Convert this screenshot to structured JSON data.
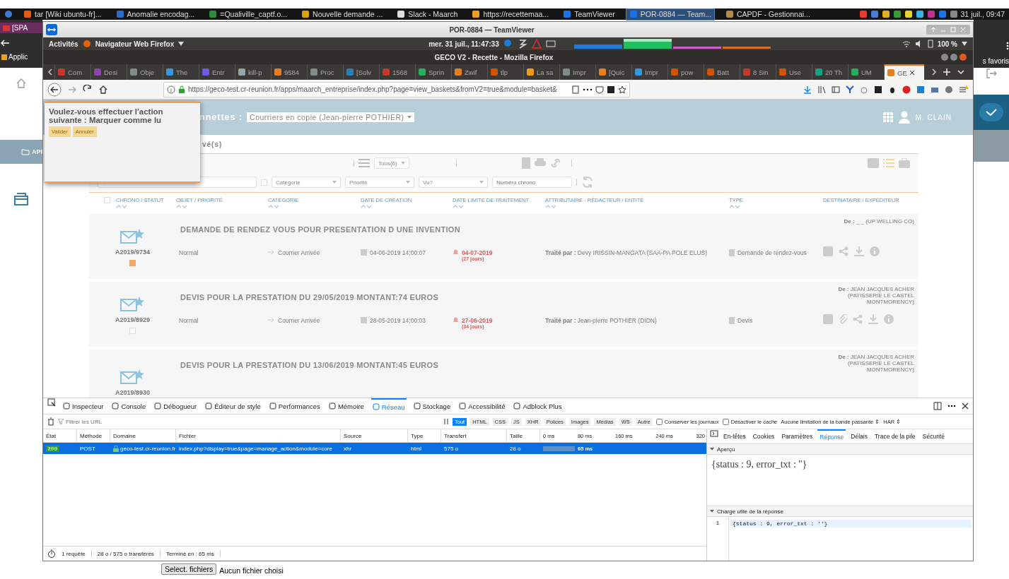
{
  "taskbar": {
    "items": [
      {
        "label": "tar [Wiki ubuntu-fr]...",
        "selected": false
      },
      {
        "label": "Anomalie encodag...",
        "selected": false
      },
      {
        "label": "=Qualiville_captf.o...",
        "selected": false
      },
      {
        "label": "Nouvelle demande ...",
        "selected": false
      },
      {
        "label": "Slack - Maarch",
        "selected": false
      },
      {
        "label": "https://recettemaa...",
        "selected": false
      },
      {
        "label": "TeamViewer",
        "selected": false
      },
      {
        "label": "POR-0884 — Team...",
        "selected": true
      },
      {
        "label": "CAPDF - Gestionnai...",
        "selected": false
      }
    ],
    "clock": "31 juil., 09:47"
  },
  "background_window": {
    "tab": "[SPA",
    "launcher": "Applic",
    "bookmarks": "s favoris",
    "side_label": "API",
    "file_button": "Select. fichiers",
    "file_status": "Aucun fichier choisi"
  },
  "teamviewer": {
    "title": "POR-0884 — TeamViewer"
  },
  "remote_topbar": {
    "activities": "Activités",
    "app_menu": "Navigateur Web Firefox",
    "clock": "mer. 31 juil., 11:47:33",
    "battery": "100 %"
  },
  "firefox": {
    "title": "GECO V2 - Recette - Mozilla Firefox",
    "tabs": [
      {
        "label": "Com",
        "selected": false
      },
      {
        "label": "Desi",
        "selected": false
      },
      {
        "label": "Obje",
        "selected": false
      },
      {
        "label": "The",
        "selected": false
      },
      {
        "label": "Entr",
        "selected": false
      },
      {
        "label": "kill-p",
        "selected": false
      },
      {
        "label": "9584",
        "selected": false
      },
      {
        "label": "Proc",
        "selected": false
      },
      {
        "label": "[Solv",
        "selected": false
      },
      {
        "label": "1568",
        "selected": false
      },
      {
        "label": "Sprin",
        "selected": false
      },
      {
        "label": "Zwif",
        "selected": false
      },
      {
        "label": "tlp",
        "selected": false
      },
      {
        "label": "La sa",
        "selected": false
      },
      {
        "label": "Impr",
        "selected": false
      },
      {
        "label": "[Quic",
        "selected": false
      },
      {
        "label": "Impr",
        "selected": false
      },
      {
        "label": "pow",
        "selected": false
      },
      {
        "label": "Batt",
        "selected": false
      },
      {
        "label": "8 Sin",
        "selected": false
      },
      {
        "label": "Use",
        "selected": false
      },
      {
        "label": "20 Th",
        "selected": false
      },
      {
        "label": "UM",
        "selected": false
      },
      {
        "label": "GE",
        "selected": true
      }
    ],
    "url": "https://geco-test.cr-reunion.fr/apps/maarch_entreprise/index.php?page=view_baskets&fromV2=true&module=basket&"
  },
  "page": {
    "header": {
      "basket_label": "nnettes :",
      "basket_select": "Courriers en copie (Jean-pierre POTHIER)",
      "user": "M. CLAIN"
    },
    "subtitle": "vé(s)",
    "toolbar": {
      "filter_checkbox": {
        "checked": false
      },
      "select_all": {
        "checked": false
      },
      "count_select": "Tous(6)",
      "filters": [
        "Catégorie",
        "Priorité",
        "Vu?"
      ],
      "chrono_placeholder": "Numéro chrono"
    },
    "columns": [
      "CHRONO / STATUT",
      "OBJET / PRIORITÉ",
      "CATÉGORIE",
      "DATE DE CRÉATION",
      "DATE LIMITE DE TRAITEMENT",
      "ATTRIBUTAIRE - RÉDACTEUR / ENTITÉ",
      "TYPE",
      "DESTINATAIRE / EXPÉDITEUR"
    ],
    "rows": [
      {
        "chrono": "A2019/9734",
        "checked": true,
        "subject": "DEMANDE DE RENDEZ VOUS POUR PRESENTATION D UNE INVENTION",
        "contact": "**De :** _ _ (UP WELLING CO)",
        "priority": "Normal",
        "category": "Courrier Arrivée",
        "created": "04-06-2019 14:00:07",
        "deadline": "04-07-2019",
        "remaining": "(27 jours)",
        "assignee": "**Traité par :** Devy IRISSIN-MANGATA (SAA-PA POLE ELUS)",
        "type": "Demande de rendez-vous",
        "attachment": false
      },
      {
        "chrono": "A2019/8929",
        "checked": false,
        "subject": "DEVIS POUR LA PRESTATION DU 29/05/2019 MONTANT:74 EUROS",
        "contact": "**De :** JEAN JACQUES ACHER (PATISSERIE LE CASTEL MONTMORENCY)",
        "priority": "Normal",
        "category": "Courrier Arrivée",
        "created": "28-05-2019 14:00:03",
        "deadline": "27-06-2019",
        "remaining": "(34 jours)",
        "assignee": "**Traité par :** Jean-pierre POTHIER (DIDN)",
        "type": "Devis",
        "attachment": true
      },
      {
        "chrono": "A2019/8930",
        "subject": "DEVIS POUR LA PRESTATION DU 13/06/2019 MONTANT:45 EUROS",
        "contact": "**De :** JEAN JACQUES ACHER (PATISSERIE LE CASTEL MONTMORENCY)"
      }
    ],
    "dialog": {
      "message": "Voulez-vous effectuer l'action suivante : Marquer comme lu",
      "buttons": [
        "Valider",
        "Annuler"
      ]
    }
  },
  "devtools": {
    "tabs": [
      {
        "label": "Inspecteur",
        "selected": false
      },
      {
        "label": "Console",
        "selected": false
      },
      {
        "label": "Débogueur",
        "selected": false
      },
      {
        "label": "Éditeur de style",
        "selected": false
      },
      {
        "label": "Performances",
        "selected": false
      },
      {
        "label": "Mémoire",
        "selected": false
      },
      {
        "label": "Réseau",
        "selected": true
      },
      {
        "label": "Stockage",
        "selected": false
      },
      {
        "label": "Accessibilité",
        "selected": false
      },
      {
        "label": "Adblock Plus",
        "selected": false
      }
    ],
    "filter_placeholder": "Filtrer les URL",
    "type_filters": [
      {
        "label": "Tout",
        "selected": true
      },
      {
        "label": "HTML",
        "selected": false
      },
      {
        "label": "CSS",
        "selected": false
      },
      {
        "label": "JS",
        "selected": false
      },
      {
        "label": "XHR",
        "selected": false
      },
      {
        "label": "Polices",
        "selected": false
      },
      {
        "label": "Images",
        "selected": false
      },
      {
        "label": "Médias",
        "selected": false
      },
      {
        "label": "WS",
        "selected": false
      },
      {
        "label": "Autre",
        "selected": false
      }
    ],
    "options": [
      {
        "label": "Conserver les journaux",
        "checked": false
      },
      {
        "label": "Désactiver le cache",
        "checked": false
      }
    ],
    "throttling": "Aucune limitation de la bande passante ⇕",
    "har": "HAR ⇕",
    "columns": [
      "État",
      "Méthode",
      "Domaine",
      "Fichier",
      "Source",
      "Type",
      "Transfert",
      "Taille"
    ],
    "timeline_ticks": [
      "0 ms",
      "80 ms",
      "160 ms",
      "240 ms",
      "320"
    ],
    "request": {
      "selected": true,
      "cells": [
        "200",
        "POST",
        "geco-test.cr-reunion.fr",
        "index.php?display=true&page=manage_action&module=core",
        "xhr",
        "html",
        "575 o",
        "28 o"
      ],
      "timing": "65 ms"
    },
    "side_tabs": [
      {
        "label": "En-têtes",
        "selected": false
      },
      {
        "label": "Cookies",
        "selected": false
      },
      {
        "label": "Paramètres",
        "selected": false
      },
      {
        "label": "Réponse",
        "selected": true
      },
      {
        "label": "Délais",
        "selected": false
      },
      {
        "label": "Trace de la pile",
        "selected": false
      },
      {
        "label": "Sécurité",
        "selected": false
      }
    ],
    "preview_title": "Aperçu",
    "preview": "{status : 9, error_txt : ''}",
    "payload_title": "Charge utile de la réponse",
    "payload_line": "1",
    "payload": "{status : 9, error_txt : ''}",
    "status": [
      "1 requête",
      "28 o / 575 o transférés",
      "Terminé en : 65 ms"
    ]
  }
}
